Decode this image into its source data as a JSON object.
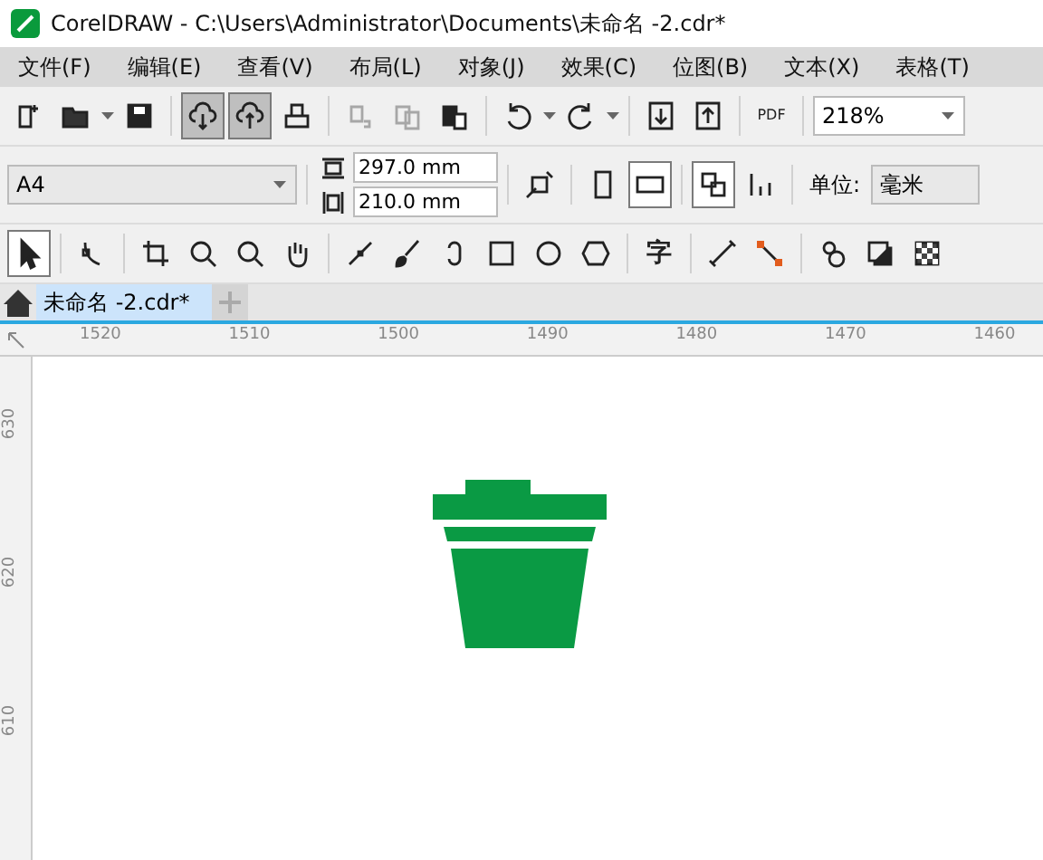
{
  "window": {
    "title": "CorelDRAW - C:\\Users\\Administrator\\Documents\\未命名 -2.cdr*"
  },
  "menu": [
    "文件(F)",
    "编辑(E)",
    "查看(V)",
    "布局(L)",
    "对象(J)",
    "效果(C)",
    "位图(B)",
    "文本(X)",
    "表格(T)"
  ],
  "toolbar": [
    {
      "selected": false,
      "disabled": false
    },
    {
      "selected": false,
      "disabled": false
    },
    {
      "selected": false,
      "disabled": false
    },
    {
      "selected": true,
      "disabled": false
    },
    {
      "selected": true,
      "disabled": false
    },
    {
      "selected": false,
      "disabled": false
    },
    {
      "selected": false,
      "disabled": true
    },
    {
      "selected": false,
      "disabled": true
    },
    {
      "selected": false,
      "disabled": false
    },
    {
      "selected": false,
      "disabled": false
    },
    {
      "selected": false,
      "disabled": false
    },
    {
      "selected": false,
      "disabled": false
    },
    {
      "selected": false,
      "disabled": false
    }
  ],
  "pdf_label": "PDF",
  "zoom": "218%",
  "property_bar": {
    "page_size": "A4",
    "width": "297.0 mm",
    "height": "210.0 mm",
    "orientation": [
      {
        "selected": false
      },
      {
        "selected": true
      }
    ],
    "page_layout": [
      {
        "selected": true
      },
      {
        "selected": false
      }
    ],
    "unit_label": "单位:",
    "unit": "毫米"
  },
  "toolbox": [
    {
      "selected": true
    },
    {
      "selected": false
    },
    {
      "selected": false
    },
    {
      "selected": false
    },
    {
      "selected": false
    },
    {
      "selected": false
    },
    {
      "selected": false
    },
    {
      "selected": false
    },
    {
      "selected": false
    },
    {
      "selected": false
    },
    {
      "selected": false
    },
    {
      "selected": false
    },
    {
      "selected": false
    },
    {
      "selected": false
    },
    {
      "selected": false
    },
    {
      "selected": false
    },
    {
      "selected": false
    },
    {
      "selected": false
    }
  ],
  "text_tool": "字",
  "tabs": [
    {
      "label": "未命名 -2.cdr*",
      "selected": true
    }
  ],
  "ruler_h": [
    "1520",
    "1510",
    "1500",
    "1490",
    "1480",
    "1470",
    "1460"
  ],
  "ruler_v": [
    "630",
    "620",
    "610"
  ]
}
